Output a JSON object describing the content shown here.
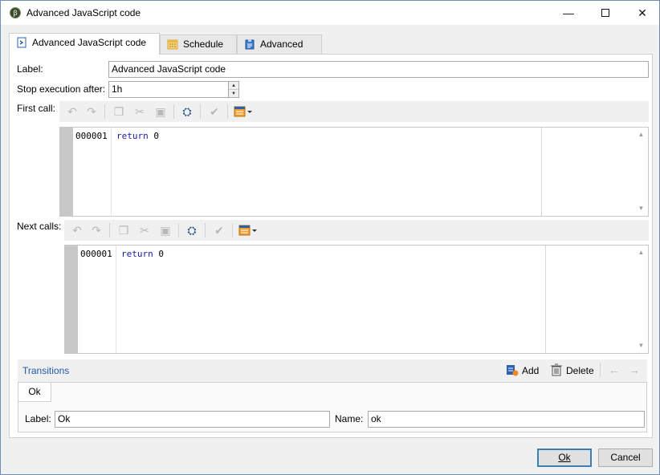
{
  "window": {
    "title": "Advanced JavaScript code",
    "minimize_glyph": "—",
    "close_glyph": "✕",
    "app_icon_glyph": "β"
  },
  "tabs": [
    {
      "label": "Advanced JavaScript code",
      "icon": "script-icon"
    },
    {
      "label": "Schedule",
      "icon": "calendar-icon"
    },
    {
      "label": "Advanced",
      "icon": "clipboard-icon"
    }
  ],
  "form": {
    "label_caption": "Label:",
    "label_value": "Advanced JavaScript code",
    "stop_caption": "Stop execution after:",
    "stop_value": "1h",
    "first_call_caption": "First call:",
    "next_calls_caption": "Next calls:"
  },
  "editors": {
    "first": {
      "line_no": "000001",
      "keyword": "return",
      "rest": " 0"
    },
    "next": {
      "line_no": "000001",
      "keyword": "return",
      "rest": " 0"
    }
  },
  "transitions": {
    "title": "Transitions",
    "add_label": "Add",
    "delete_label": "Delete",
    "tab_label": "Ok",
    "label_caption": "Label:",
    "label_value": "Ok",
    "name_caption": "Name:",
    "name_value": "ok"
  },
  "footer": {
    "ok_label": "Ok",
    "cancel_label": "Cancel"
  },
  "colors": {
    "link": "#1f5aa8",
    "keyword": "#1a1aa6",
    "default_button_border": "#3c7fb1"
  }
}
